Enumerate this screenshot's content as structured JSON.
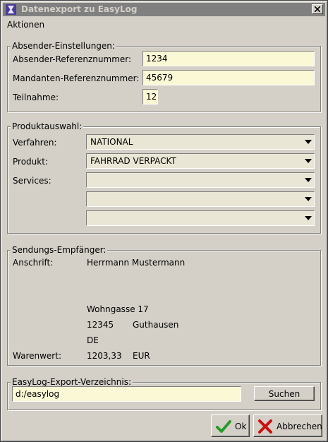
{
  "window": {
    "title": "Datenexport zu EasyLog"
  },
  "menu": {
    "items": [
      "Aktionen"
    ]
  },
  "sender": {
    "legend": "Absender-Einstellungen:",
    "ref_label": "Absender-Referenznummer:",
    "ref_value": "1234",
    "client_label": "Mandanten-Referenznummer:",
    "client_value": "45679",
    "participation_label": "Teilnahme:",
    "participation_value": "12"
  },
  "product": {
    "legend": "Produktauswahl:",
    "procedure_label": "Verfahren:",
    "procedure_value": "NATIONAL",
    "product_label": "Produkt:",
    "product_value": "FAHRRAD VERPACKT",
    "services_label": "Services:",
    "services_values": [
      "",
      "",
      ""
    ]
  },
  "recipient": {
    "legend": "Sendungs-Empfänger:",
    "address_label": "Anschrift:",
    "name": "Herrmann Mustermann",
    "street": "Wohngasse 17",
    "zip": "12345",
    "city": "Guthausen",
    "country": "DE",
    "value_label": "Warenwert:",
    "value_amount": "1203,33",
    "value_currency": "EUR"
  },
  "export": {
    "legend": "EasyLog-Export-Verzeichnis:",
    "path": "d:/easylog",
    "search_label": "Suchen"
  },
  "buttons": {
    "ok_label": "Ok",
    "cancel_label": "Abbrechen"
  },
  "colors": {
    "field_bg": "#fbf8d6",
    "combo_bg": "#e9e6d5",
    "ok_icon": "#2a9a2a",
    "cancel_icon": "#cc1010"
  },
  "icons": {
    "window": "app-icon",
    "close": "close-icon",
    "ok": "checkmark-icon",
    "cancel": "cross-icon",
    "dropdown": "chevron-down-icon"
  }
}
